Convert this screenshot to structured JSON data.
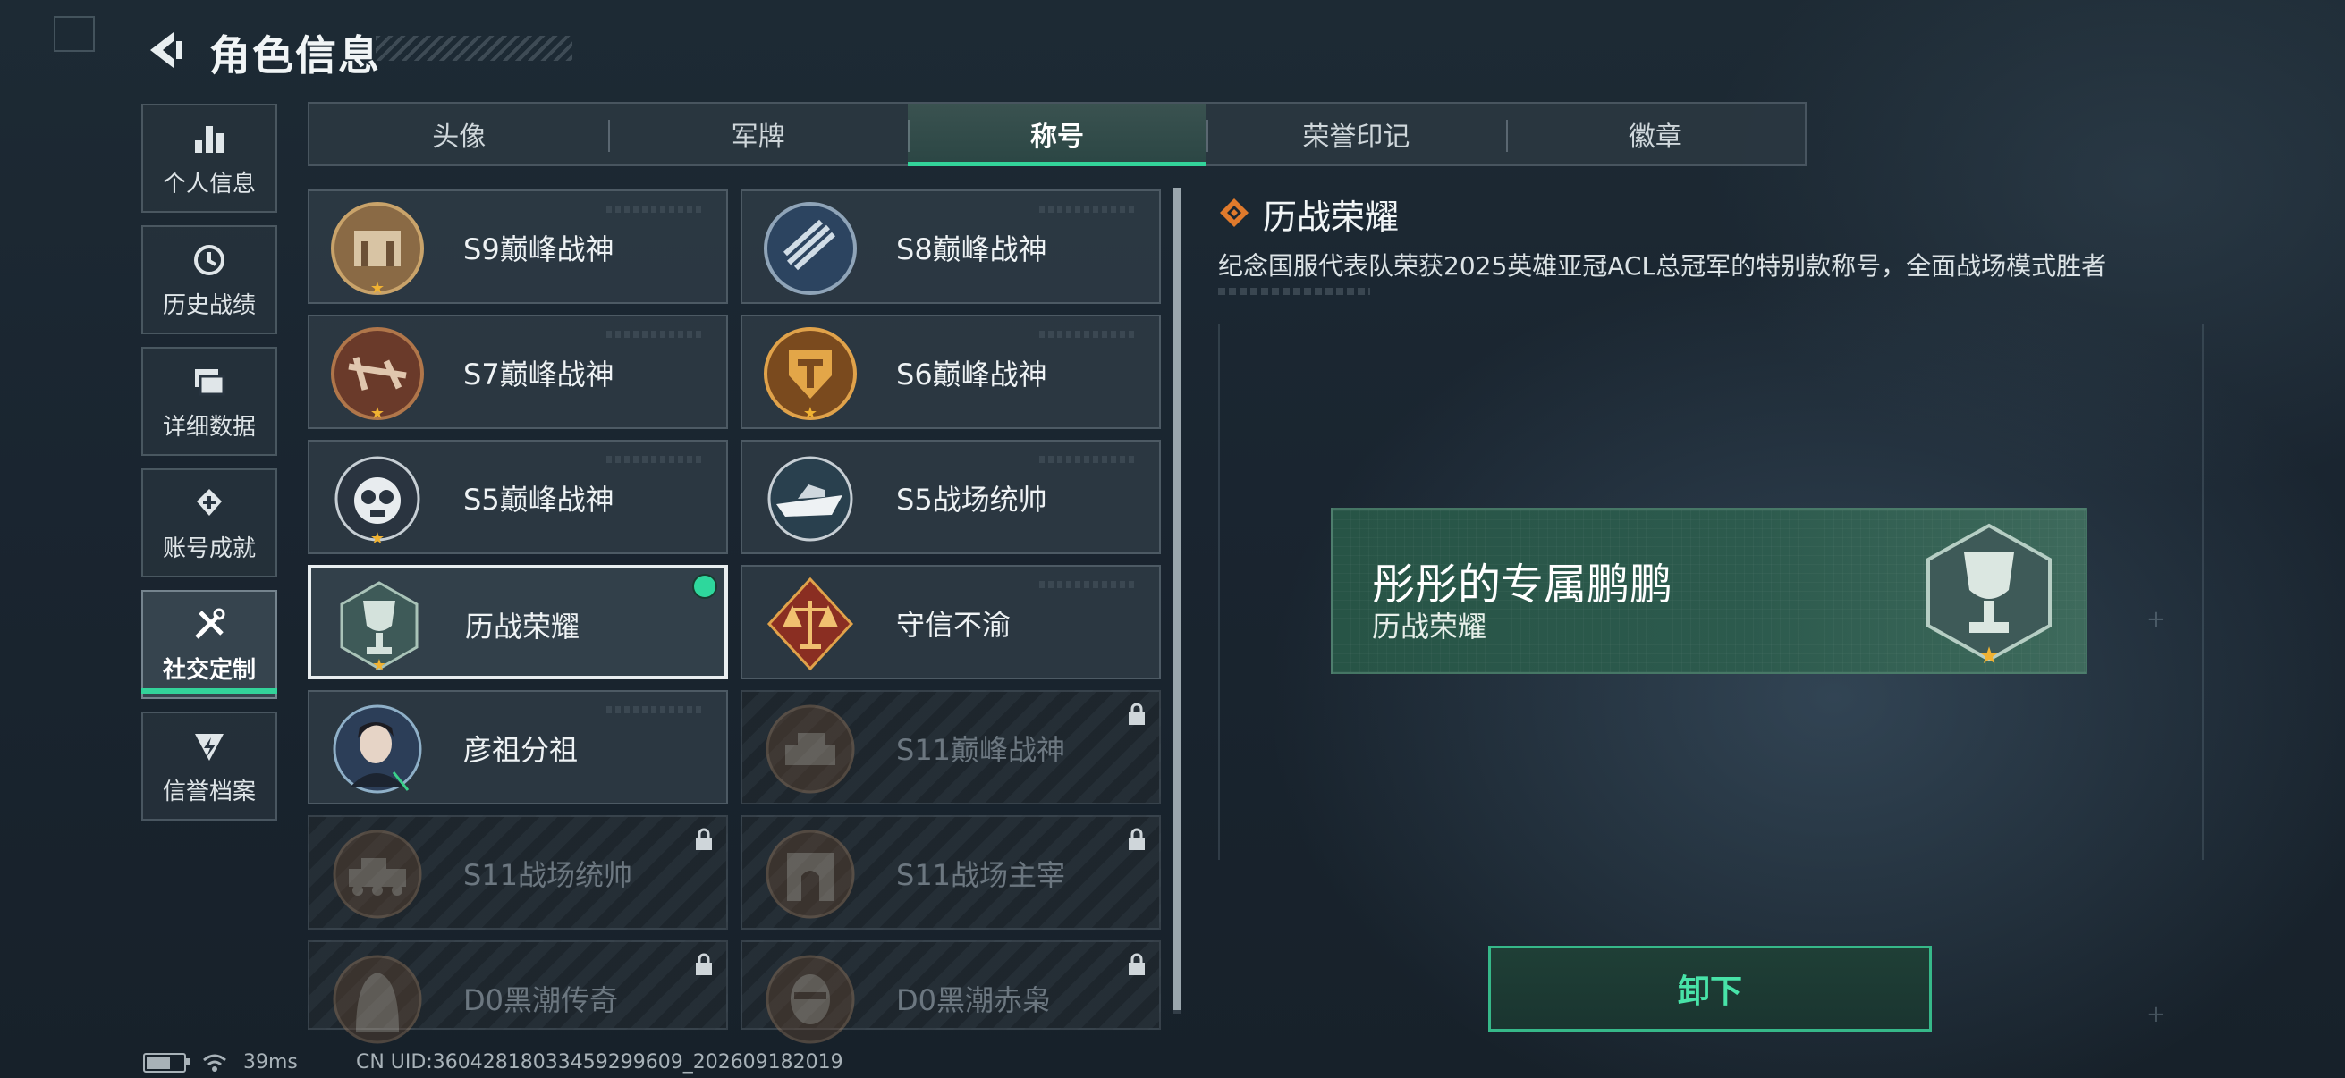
{
  "header": {
    "title": "角色信息"
  },
  "nav": {
    "items": [
      {
        "label": "个人信息",
        "icon": "bar-chart-icon"
      },
      {
        "label": "历史战绩",
        "icon": "clock-icon"
      },
      {
        "label": "详细数据",
        "icon": "folders-icon"
      },
      {
        "label": "账号成就",
        "icon": "achievement-icon"
      },
      {
        "label": "社交定制",
        "icon": "tools-icon",
        "active": true
      },
      {
        "label": "信誉档案",
        "icon": "credit-icon"
      }
    ]
  },
  "tabs": {
    "items": [
      "头像",
      "军牌",
      "称号",
      "荣誉印记",
      "徽章"
    ],
    "active_index": 2
  },
  "titles": [
    {
      "name": "S9巅峰战神",
      "locked": false
    },
    {
      "name": "S8巅峰战神",
      "locked": false
    },
    {
      "name": "S7巅峰战神",
      "locked": false
    },
    {
      "name": "S6巅峰战神",
      "locked": false
    },
    {
      "name": "S5巅峰战神",
      "locked": false
    },
    {
      "name": "S5战场统帅",
      "locked": false
    },
    {
      "name": "历战荣耀",
      "locked": false,
      "selected": true,
      "equipped": true
    },
    {
      "name": "守信不渝",
      "locked": false
    },
    {
      "name": "彦祖分祖",
      "locked": false
    },
    {
      "name": "S11巅峰战神",
      "locked": true
    },
    {
      "name": "S11战场统帅",
      "locked": true
    },
    {
      "name": "S11战场主宰",
      "locked": true
    },
    {
      "name": "D0黑潮传奇",
      "locked": true
    },
    {
      "name": "D0黑潮赤枭",
      "locked": true
    }
  ],
  "detail": {
    "title": "历战荣耀",
    "description": "纪念国服代表队荣获2025英雄亚冠ACL总冠军的特别款称号，全面战场模式胜者",
    "banner_player": "彤彤的专属鹏鹏",
    "banner_title": "历战荣耀",
    "unequip_label": "卸下"
  },
  "status": {
    "ping": "39ms",
    "uid": "CN UID:36042818033459299609_202609182019"
  },
  "colors": {
    "accent": "#33d39a",
    "banner": "#2c5a4d",
    "equipped_dot": "#2ed79c"
  }
}
